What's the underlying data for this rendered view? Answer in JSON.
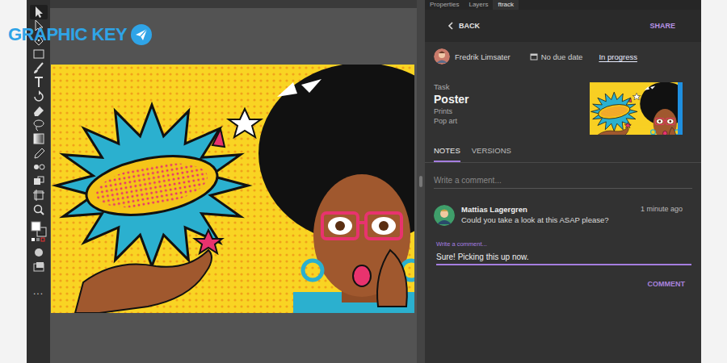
{
  "watermark": {
    "text": "GRAPHIC KEY"
  },
  "panel_tabs": [
    {
      "label": "Properties",
      "selected": false
    },
    {
      "label": "Layers",
      "selected": false
    },
    {
      "label": "ftrack",
      "selected": true
    }
  ],
  "header": {
    "back": "BACK",
    "share": "SHARE"
  },
  "task_meta": {
    "assignee": "Fredrik Limsater",
    "due": "No due date",
    "status": "In progress"
  },
  "task": {
    "label": "Task",
    "name": "Poster",
    "path": [
      "Prints",
      "Pop art"
    ]
  },
  "note_tabs": [
    {
      "label": "NOTES",
      "selected": true
    },
    {
      "label": "VERSIONS",
      "selected": false
    }
  ],
  "comment_field": {
    "placeholder": "Write a comment..."
  },
  "notes": [
    {
      "author": "Mattias Lagergren",
      "time": "1 minute ago",
      "text": "Could you take a look at this ASAP please?",
      "reply": {
        "label": "Write a comment...",
        "value": "Sure! Picking this up now."
      }
    }
  ],
  "comment_button": "COMMENT",
  "toolbar": {
    "more": "..."
  }
}
